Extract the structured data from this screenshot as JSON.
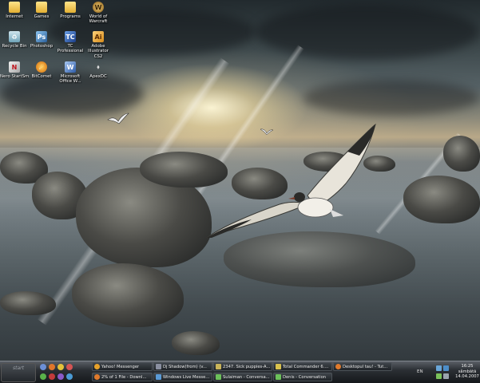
{
  "desktop": {
    "icons": [
      {
        "label": "Internet",
        "icon": "folder-icon"
      },
      {
        "label": "Games",
        "icon": "folder-icon"
      },
      {
        "label": "Programs",
        "icon": "folder-icon"
      },
      {
        "label": "World of Warcraft",
        "icon": "world-of-warcraft-icon"
      },
      {
        "label": "Recycle Bin",
        "icon": "recycle-bin-icon"
      },
      {
        "label": "Photoshop",
        "icon": "photoshop-icon"
      },
      {
        "label": "TC Professional",
        "icon": "total-commander-icon"
      },
      {
        "label": "Adobe Illustrator CS2",
        "icon": "illustrator-icon"
      },
      {
        "label": "Nero StartSmart",
        "icon": "nero-icon"
      },
      {
        "label": "BitComet",
        "icon": "bitcomet-icon"
      },
      {
        "label": "Microsoft Office W...",
        "icon": "word-icon"
      },
      {
        "label": "ApexDC",
        "icon": "apexdc-icon"
      }
    ]
  },
  "taskbar": {
    "start_label": "start",
    "tasks_row1": [
      {
        "label": "Yahoo! Messenger",
        "icon": "yahoo-messenger-icon",
        "color": "#e7a12a"
      },
      {
        "label": "Dj Shadow(from) (v...",
        "icon": "winamp-icon",
        "color": "#8a8fa0"
      },
      {
        "label": "2347. Sick puppies-A...",
        "icon": "audio-icon",
        "color": "#c9b45a"
      },
      {
        "label": "Total Commander 6....",
        "icon": "total-commander-icon",
        "color": "#d9c24d"
      },
      {
        "label": "Desktopul tau! - Tut...",
        "icon": "firefox-icon",
        "color": "#e07a2c"
      }
    ],
    "tasks_row2": [
      {
        "label": "2% of 1 File - Downl...",
        "icon": "firefox-icon",
        "color": "#e07a2c"
      },
      {
        "label": "Windows Live Messe...",
        "icon": "live-messenger-icon",
        "color": "#5a9ad6"
      },
      {
        "label": "Sulaiman - Conversa...",
        "icon": "live-messenger-icon",
        "color": "#6cc05a"
      },
      {
        "label": "Denis - Conversation",
        "icon": "live-messenger-icon",
        "color": "#6cc05a"
      }
    ],
    "tray": {
      "language": "EN",
      "time": "16:25",
      "day": "sâmbătă",
      "date": "14.04.2007"
    }
  }
}
